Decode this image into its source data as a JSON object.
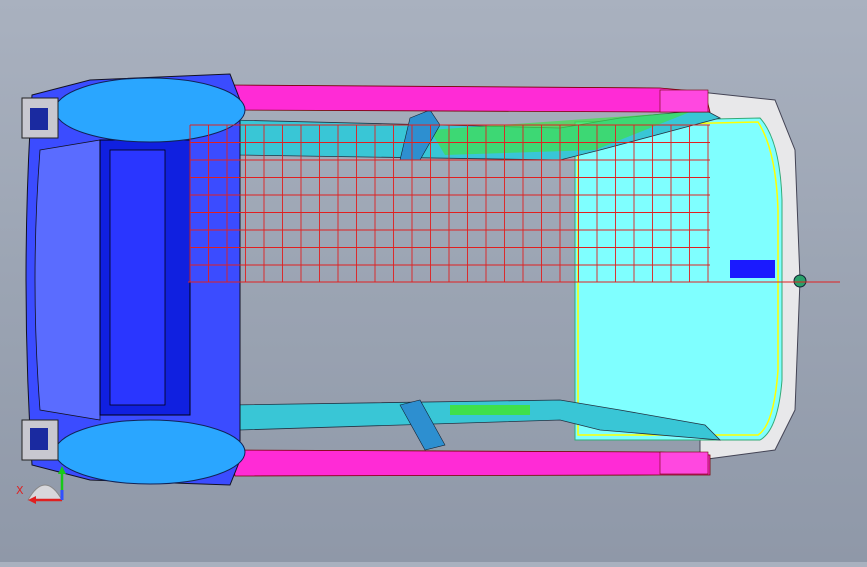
{
  "viewport": {
    "name": "cad-3d-viewport",
    "background_top": "#a9b1bf",
    "background_bottom": "#8f98a8"
  },
  "model": {
    "colors": {
      "roof_rail": "#ff2bd6",
      "floor_panel": "#7fffff",
      "seat_frame": "#2e3cff",
      "wheelhouse": "#2aa6ff",
      "reinforcement": "#2ee03a",
      "grid_lines": "#e02020",
      "outline": "#ffff00"
    }
  },
  "axis_triad": {
    "x_label": "X",
    "x_color": "#e02020",
    "y_color": "#18c818",
    "z_color": "#3050ff"
  }
}
